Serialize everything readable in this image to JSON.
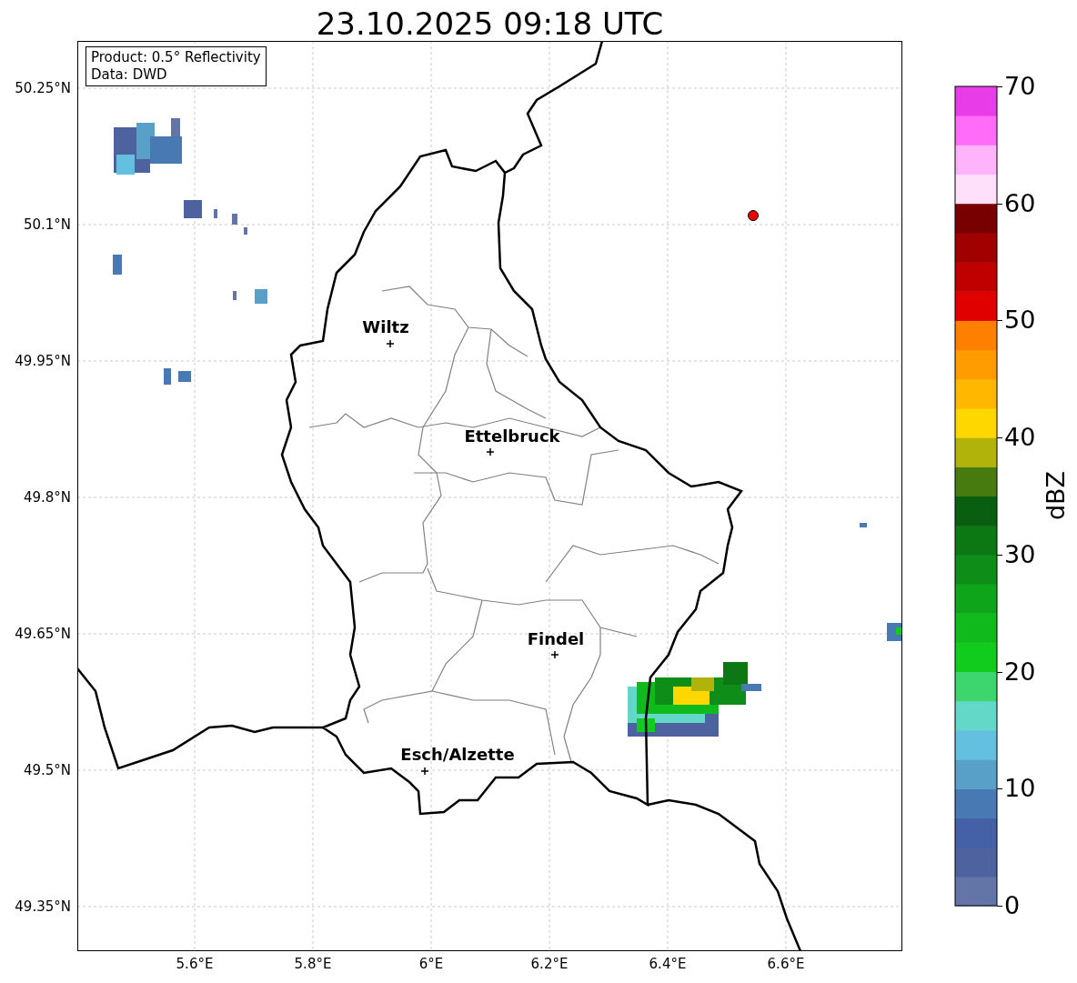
{
  "title": "23.10.2025 09:18 UTC",
  "info_box": {
    "lines": [
      "Product: 0.5° Reflectivity",
      "Data: DWD"
    ]
  },
  "map": {
    "xticks": [
      "5.6°E",
      "5.8°E",
      "6°E",
      "6.2°E",
      "6.4°E",
      "6.6°E"
    ],
    "yticks": [
      "50.25°N",
      "50.1°N",
      "49.95°N",
      "49.8°N",
      "49.65°N",
      "49.5°N",
      "49.35°N"
    ],
    "cities": [
      {
        "name": "Wiltz"
      },
      {
        "name": "Ettelbruck"
      },
      {
        "name": "Findel"
      },
      {
        "name": "Esch/Alzette"
      }
    ]
  },
  "colorbar": {
    "label": "dBZ",
    "ticks": [
      "70",
      "60",
      "50",
      "40",
      "30",
      "20",
      "10",
      "0"
    ],
    "bins": [
      {
        "color": "#6374a6"
      },
      {
        "color": "#4f62a0"
      },
      {
        "color": "#4460a6"
      },
      {
        "color": "#4979b3"
      },
      {
        "color": "#59a0c8"
      },
      {
        "color": "#63c1df"
      },
      {
        "color": "#63d8c8"
      },
      {
        "color": "#3dd56e"
      },
      {
        "color": "#11cc1c"
      },
      {
        "color": "#10b91c"
      },
      {
        "color": "#0fa51a"
      },
      {
        "color": "#0e8d18"
      },
      {
        "color": "#0b7814"
      },
      {
        "color": "#095e0f"
      },
      {
        "color": "#477a0f"
      },
      {
        "color": "#b1b30a"
      },
      {
        "color": "#ffd700"
      },
      {
        "color": "#ffb700"
      },
      {
        "color": "#ff9c00"
      },
      {
        "color": "#ff7f00"
      },
      {
        "color": "#e10000"
      },
      {
        "color": "#c00000"
      },
      {
        "color": "#a00000"
      },
      {
        "color": "#780000"
      },
      {
        "color": "#ffe0fa"
      },
      {
        "color": "#ffb3fb"
      },
      {
        "color": "#ff6df8"
      },
      {
        "color": "#e93ce9"
      }
    ]
  }
}
